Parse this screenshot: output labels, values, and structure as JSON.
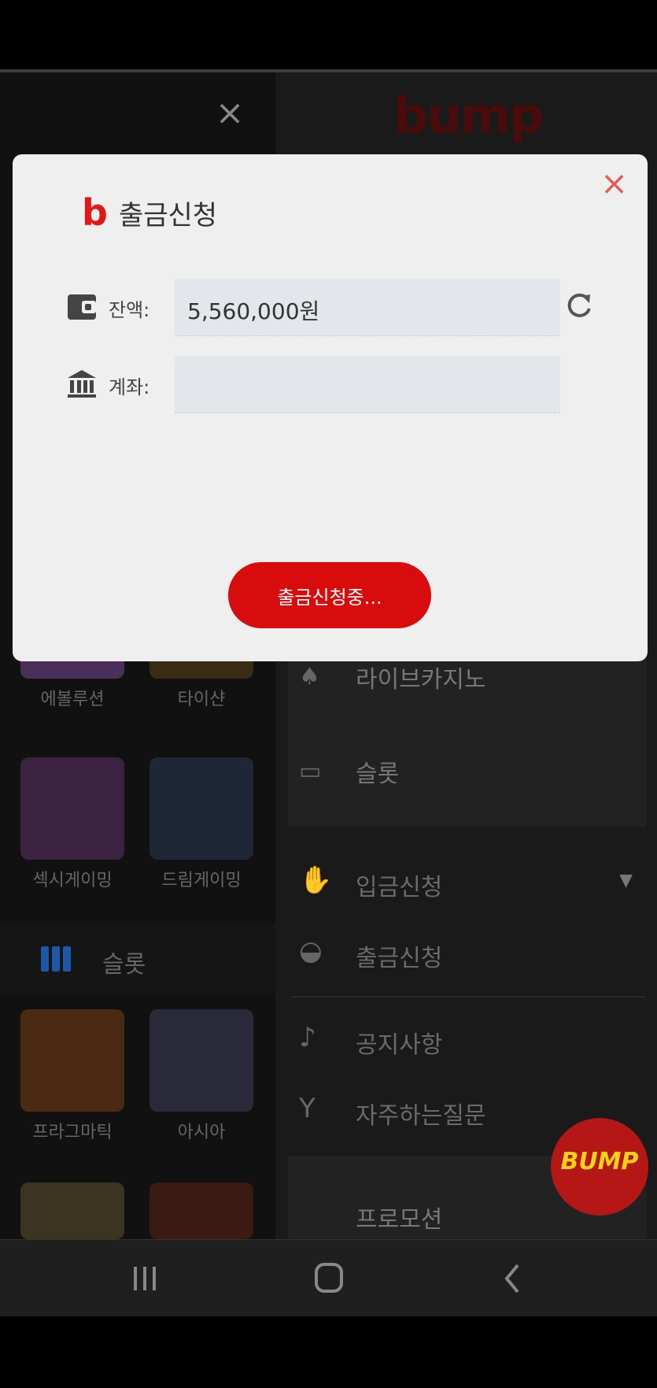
{
  "background": {
    "brand_logo": "bump",
    "left_games": [
      {
        "label": "에볼루션",
        "color": "#4a2f5a"
      },
      {
        "label": "타이샨",
        "color": "#3a2c14"
      },
      {
        "label": "섹시게이밍",
        "color": "#3b2240"
      },
      {
        "label": "드림게이밍",
        "color": "#1f2636"
      },
      {
        "label": "프라그마틱",
        "color": "#4a2a12"
      },
      {
        "label": "아시아",
        "color": "#2b2a3a"
      }
    ],
    "slot_section_title": "슬롯",
    "right_banners": [
      "라이브카지노",
      "슬롯"
    ],
    "menu": [
      {
        "icon": "hand-coins-icon",
        "label": "입금신청",
        "caret": "▼"
      },
      {
        "icon": "money-bag-icon",
        "label": "출금신청"
      },
      {
        "icon": "bell-icon",
        "label": "공지사항"
      },
      {
        "icon": "cocktail-icon",
        "label": "자주하는질문"
      }
    ],
    "bottom_banner": "프로모션",
    "fab_label": "BUMP"
  },
  "modal": {
    "title": "출금신청",
    "logo_letter": "b",
    "balance_label": "잔액:",
    "balance_value": "5,560,000원",
    "account_label": "계좌:",
    "account_value": "",
    "submit_label": "출금신청중...",
    "accent": "#d80c0c"
  }
}
